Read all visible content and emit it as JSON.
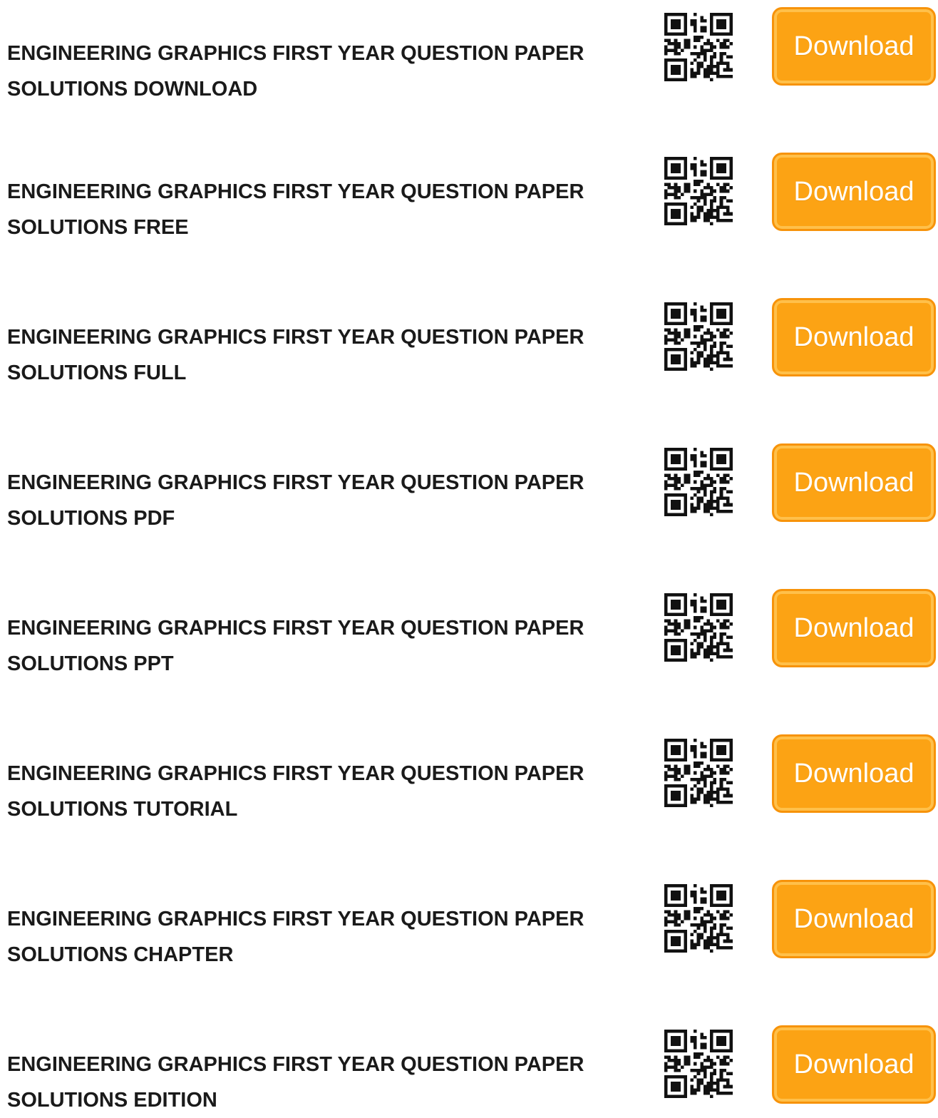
{
  "items": [
    {
      "title_line1": "ENGINEERING GRAPHICS FIRST YEAR QUESTION PAPER",
      "title_line2": "SOLUTIONS DOWNLOAD",
      "button_label": "Download"
    },
    {
      "title_line1": "ENGINEERING GRAPHICS FIRST YEAR QUESTION PAPER",
      "title_line2": "SOLUTIONS FREE",
      "button_label": "Download"
    },
    {
      "title_line1": "ENGINEERING GRAPHICS FIRST YEAR QUESTION PAPER",
      "title_line2": "SOLUTIONS FULL",
      "button_label": "Download"
    },
    {
      "title_line1": "ENGINEERING GRAPHICS FIRST YEAR QUESTION PAPER",
      "title_line2": "SOLUTIONS PDF",
      "button_label": "Download"
    },
    {
      "title_line1": "ENGINEERING GRAPHICS FIRST YEAR QUESTION PAPER",
      "title_line2": "SOLUTIONS PPT",
      "button_label": "Download"
    },
    {
      "title_line1": "ENGINEERING GRAPHICS FIRST YEAR QUESTION PAPER",
      "title_line2": "SOLUTIONS TUTORIAL",
      "button_label": "Download"
    },
    {
      "title_line1": "ENGINEERING GRAPHICS FIRST YEAR QUESTION PAPER",
      "title_line2": "SOLUTIONS CHAPTER",
      "button_label": "Download"
    },
    {
      "title_line1": "ENGINEERING GRAPHICS FIRST YEAR QUESTION PAPER",
      "title_line2": "SOLUTIONS EDITION",
      "button_label": "Download"
    }
  ],
  "icons": {
    "qr": "qr-code-icon"
  },
  "colors": {
    "button_bg": "#fca314",
    "button_border": "#f7930a",
    "button_text": "#ffffff",
    "title_text": "#1a1a1a"
  }
}
